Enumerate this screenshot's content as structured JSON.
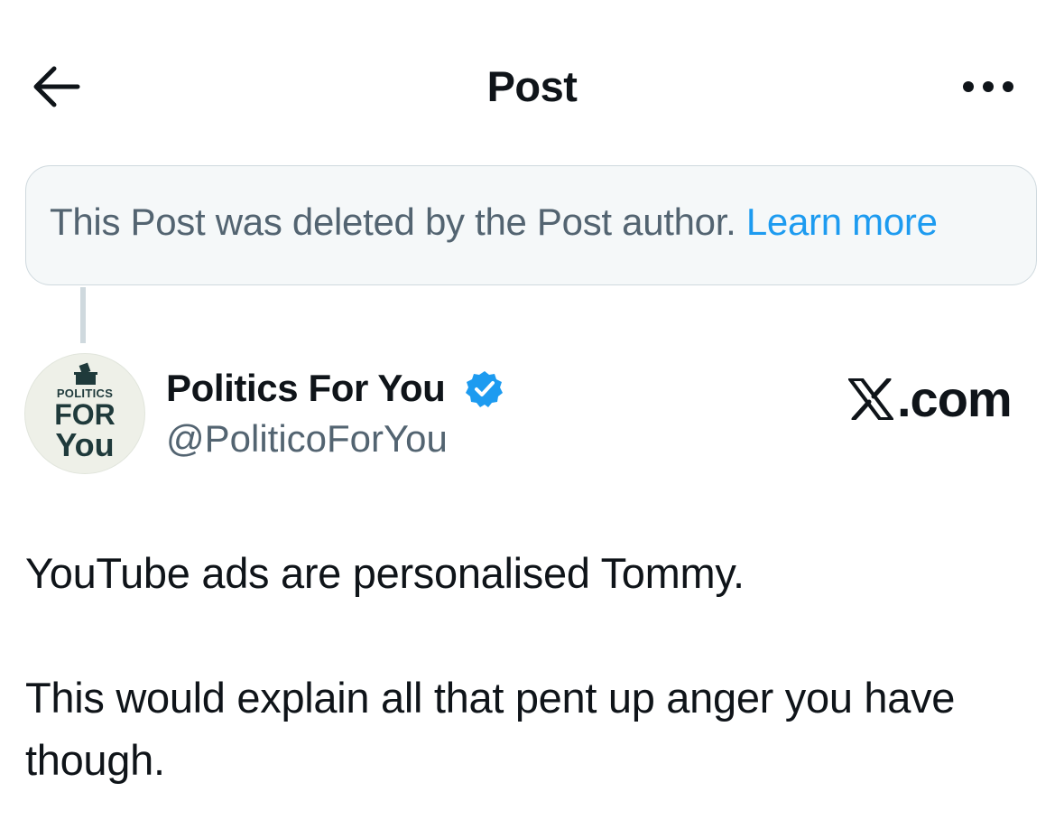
{
  "header": {
    "title": "Post",
    "back_icon": "arrow-left-icon",
    "more_icon": "more-horizontal-icon"
  },
  "deleted_notice": {
    "text": "This Post was deleted by the Post author.",
    "link_label": "Learn more"
  },
  "author": {
    "name": "Politics For You",
    "handle": "@PoliticoForYou",
    "verified": true,
    "avatar": {
      "line1": "POLITICS",
      "line2": "FOR",
      "line3": "You"
    }
  },
  "watermark": {
    "text": ".com",
    "logo": "x-logo-icon"
  },
  "post": {
    "paragraph1": "YouTube ads are personalised Tommy.",
    "paragraph2": "This would explain all that pent up anger you have though."
  },
  "colors": {
    "text_primary": "#0f1419",
    "text_secondary": "#536471",
    "link": "#1d9bf0",
    "verified": "#1d9bf0",
    "notice_bg": "#f5f8f9",
    "border": "#cfd9de"
  }
}
